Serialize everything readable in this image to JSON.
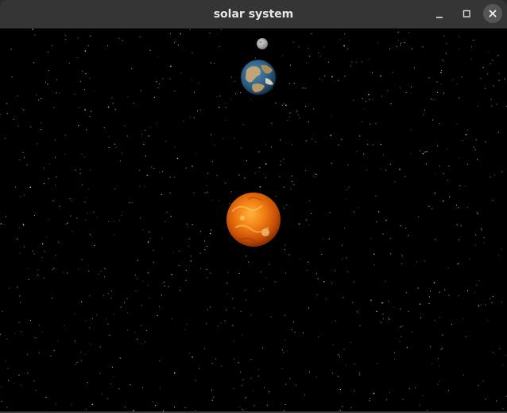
{
  "window": {
    "title": "solar system"
  },
  "titlebar_buttons": [
    "minimize",
    "maximize",
    "close"
  ],
  "scene": {
    "background_color": "#000000",
    "bodies": [
      "moon",
      "earth",
      "sun"
    ],
    "colors": {
      "sun": "#f07a10",
      "earth_ocean": "#2c5f86",
      "earth_land": "#b59a6a",
      "moon": "#a9a9a9",
      "stars": "#ffffff"
    }
  }
}
